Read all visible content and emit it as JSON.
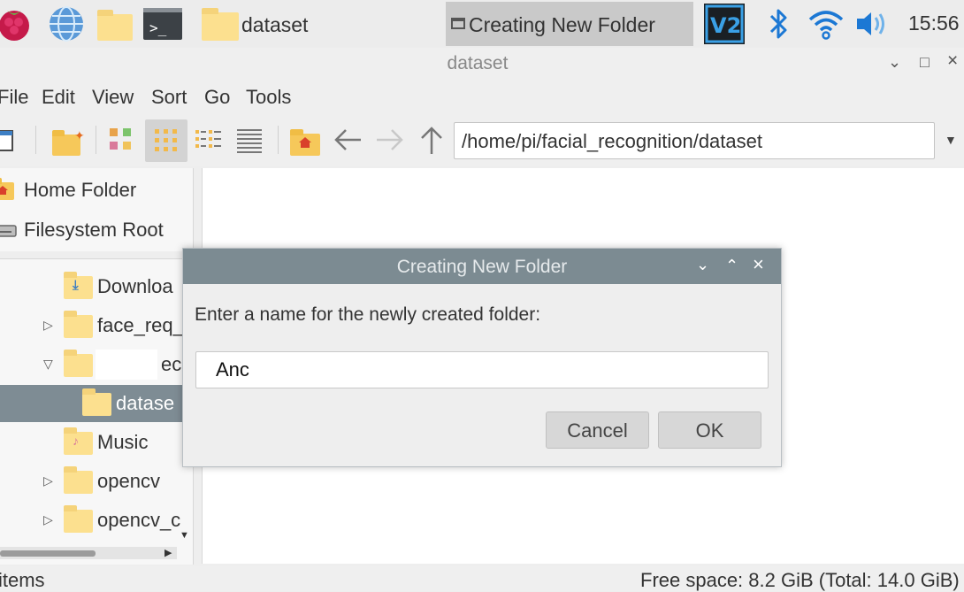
{
  "taskbar": {
    "task_dataset": "dataset",
    "task_dialog": "Creating New Folder",
    "clock": "15:56"
  },
  "window": {
    "title": "dataset",
    "controls": {
      "minimize": "⌄",
      "maximize": "□",
      "close": "×"
    }
  },
  "menubar": [
    "File",
    "Edit",
    "View",
    "Sort",
    "Go",
    "Tools"
  ],
  "toolbar": {
    "path": "/home/pi/facial_recognition/dataset"
  },
  "places": [
    {
      "label": "Home Folder",
      "icon": "home-icon"
    },
    {
      "label": "Filesystem Root",
      "icon": "drive-icon"
    }
  ],
  "tree": [
    {
      "label": "Downloa",
      "expander": "",
      "icon": "download-folder-icon"
    },
    {
      "label": "face_req_",
      "expander": "▷",
      "icon": "folder-icon"
    },
    {
      "label": "ec",
      "expander": "▽",
      "icon": "folder-icon"
    },
    {
      "label": "datase",
      "expander": "",
      "icon": "folder-icon",
      "selected": true
    },
    {
      "label": "Music",
      "expander": "",
      "icon": "music-folder-icon"
    },
    {
      "label": "opencv",
      "expander": "▷",
      "icon": "folder-icon"
    },
    {
      "label": "opencv_c",
      "expander": "▷",
      "icon": "folder-icon"
    }
  ],
  "statusbar": {
    "left": "items",
    "right": "Free space: 8.2 GiB (Total: 14.0 GiB)"
  },
  "dialog": {
    "title": "Creating New Folder",
    "prompt": "Enter a name for the newly created folder:",
    "input_value": "Anc",
    "cancel": "Cancel",
    "ok": "OK"
  },
  "colors": {
    "dialog_titlebar": "#7c8b92",
    "selection": "#7e8c94",
    "folder": "#f6c85a"
  }
}
